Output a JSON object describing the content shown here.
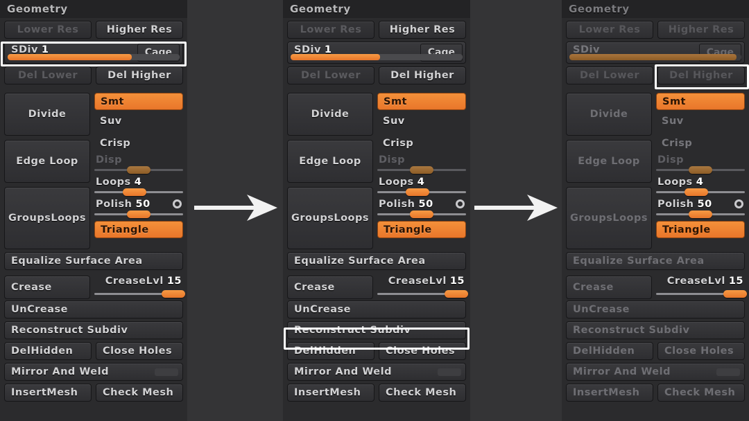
{
  "meta": {
    "app": "ZBrush Geometry palette",
    "accent_orange": "#ed7f2e",
    "panel_bg": "#2b2b2d",
    "page_bg": "#343436",
    "highlight": "#ffffff"
  },
  "panels": [
    {
      "id": "panel-1",
      "title": "Geometry",
      "dimmed": false,
      "highlight": "sdiv-row",
      "lower_res": "Lower Res",
      "higher_res": "Higher Res",
      "sdiv_label": "SDiv",
      "sdiv_value": "1",
      "sdiv_fill_pct": 72,
      "cage": "Cage",
      "del_lower": "Del Lower",
      "del_higher": "Del Higher",
      "divide": "Divide",
      "edge_loop": "Edge Loop",
      "groups_loops": "GroupsLoops",
      "smt": "Smt",
      "suv": "Suv",
      "crisp": "Crisp",
      "disp": "Disp",
      "disp_knob_pct": 50,
      "loops_label": "Loops",
      "loops_value": "4",
      "loops_knob_pct": 45,
      "polish_label": "Polish",
      "polish_value": "50",
      "polish_knob_pct": 50,
      "triangle": "Triangle",
      "equalize": "Equalize Surface Area",
      "crease": "Crease",
      "crease_lvl_label": "CreaseLvl",
      "crease_lvl_value": "15",
      "crease_lvl_knob_pct": 89,
      "uncrease": "UnCrease",
      "reconstruct": "Reconstruct Subdiv",
      "del_hidden": "DelHidden",
      "close_holes": "Close Holes",
      "mirror_and_weld": "Mirror And Weld",
      "insert_mesh": "InsertMesh",
      "check_mesh": "Check Mesh"
    },
    {
      "id": "panel-2",
      "title": "Geometry",
      "dimmed": false,
      "highlight": "reconstruct-subdiv",
      "lower_res": "Lower Res",
      "higher_res": "Higher Res",
      "sdiv_label": "SDiv",
      "sdiv_value": "1",
      "sdiv_fill_pct": 52,
      "cage": "Cage",
      "del_lower": "Del Lower",
      "del_higher": "Del Higher",
      "divide": "Divide",
      "edge_loop": "Edge Loop",
      "groups_loops": "GroupsLoops",
      "smt": "Smt",
      "suv": "Suv",
      "crisp": "Crisp",
      "disp": "Disp",
      "disp_knob_pct": 50,
      "loops_label": "Loops",
      "loops_value": "4",
      "loops_knob_pct": 45,
      "polish_label": "Polish",
      "polish_value": "50",
      "polish_knob_pct": 50,
      "triangle": "Triangle",
      "equalize": "Equalize Surface Area",
      "crease": "Crease",
      "crease_lvl_label": "CreaseLvl",
      "crease_lvl_value": "15",
      "crease_lvl_knob_pct": 89,
      "uncrease": "UnCrease",
      "reconstruct": "Reconstruct Subdiv",
      "del_hidden": "DelHidden",
      "close_holes": "Close Holes",
      "mirror_and_weld": "Mirror And Weld",
      "insert_mesh": "InsertMesh",
      "check_mesh": "Check Mesh"
    },
    {
      "id": "panel-3",
      "title": "Geometry",
      "dimmed": true,
      "highlight": "del-higher",
      "lower_res": "Lower Res",
      "higher_res": "Higher Res",
      "sdiv_label": "SDiv",
      "sdiv_value": "",
      "sdiv_fill_pct": 97,
      "cage": "Cage",
      "del_lower": "Del Lower",
      "del_higher": "Del Higher",
      "divide": "Divide",
      "edge_loop": "Edge Loop",
      "groups_loops": "GroupsLoops",
      "smt": "Smt",
      "suv": "Suv",
      "crisp": "Crisp",
      "disp": "Disp",
      "disp_knob_pct": 50,
      "loops_label": "Loops",
      "loops_value": "4",
      "loops_knob_pct": 45,
      "polish_label": "Polish",
      "polish_value": "50",
      "polish_knob_pct": 50,
      "triangle": "Triangle",
      "equalize": "Equalize Surface Area",
      "crease": "Crease",
      "crease_lvl_label": "CreaseLvl",
      "crease_lvl_value": "15",
      "crease_lvl_knob_pct": 89,
      "uncrease": "UnCrease",
      "reconstruct": "Reconstruct Subdiv",
      "del_hidden": "DelHidden",
      "close_holes": "Close Holes",
      "mirror_and_weld": "Mirror And Weld",
      "insert_mesh": "InsertMesh",
      "check_mesh": "Check Mesh"
    }
  ],
  "arrows": [
    {
      "name": "arrow-1-to-2",
      "icon": "right-arrow-icon"
    },
    {
      "name": "arrow-2-to-3",
      "icon": "right-arrow-icon"
    }
  ]
}
